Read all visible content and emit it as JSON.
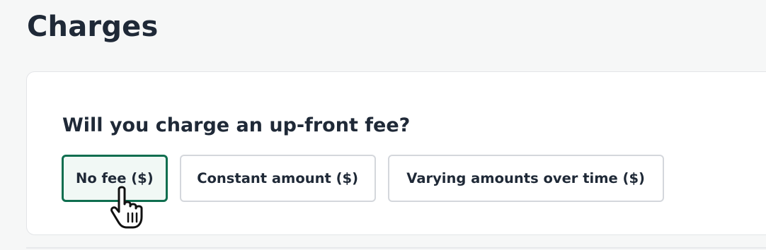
{
  "page": {
    "title": "Charges"
  },
  "charges": {
    "question": "Will you charge an up-front fee?",
    "options": [
      {
        "label": "No fee ($)",
        "selected": true
      },
      {
        "label": "Constant amount ($)",
        "selected": false
      },
      {
        "label": "Varying amounts over time ($)",
        "selected": false
      }
    ]
  },
  "colors": {
    "selected_border": "#0f6e4f",
    "selected_background": "#f1f8f5",
    "text": "#1f2937"
  },
  "cursor": {
    "icon": "hand-pointer-icon"
  }
}
